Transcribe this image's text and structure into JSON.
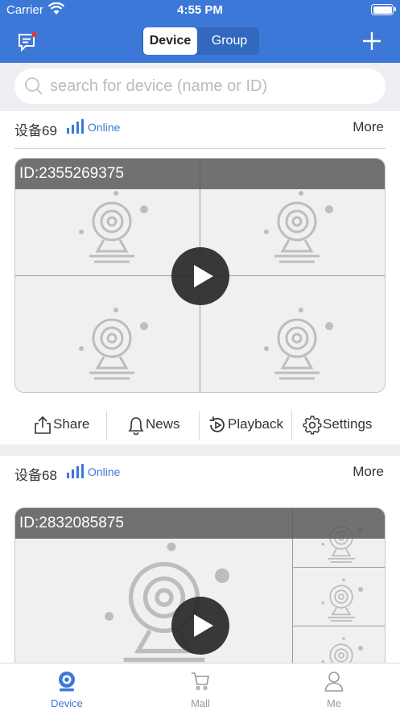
{
  "status_bar": {
    "carrier": "Carrier",
    "time": "4:55 PM"
  },
  "header": {
    "segments": [
      {
        "label": "Device",
        "selected": true
      },
      {
        "label": "Group",
        "selected": false
      }
    ]
  },
  "search": {
    "placeholder": "search for device (name or ID)",
    "value": ""
  },
  "devices": [
    {
      "name": "设备69",
      "status": "Online",
      "more": "More",
      "id_text": "ID:2355269375",
      "layout": "2x2 grid",
      "actions": [
        {
          "label": "Share",
          "icon": "share-icon"
        },
        {
          "label": "News",
          "icon": "bell-icon"
        },
        {
          "label": "Playback",
          "icon": "playback-icon"
        },
        {
          "label": "Settings",
          "icon": "gear-icon"
        }
      ]
    },
    {
      "name": "设备68",
      "status": "Online",
      "more": "More",
      "id_text": "ID:2832085875",
      "layout": "1 large + side thumbnails"
    }
  ],
  "tabs": [
    {
      "label": "Device",
      "icon": "camera-icon",
      "active": true
    },
    {
      "label": "Mall",
      "icon": "cart-icon",
      "active": false
    },
    {
      "label": "Me",
      "icon": "person-icon",
      "active": false
    }
  ],
  "colors": {
    "brand": "#3c78d8",
    "online": "#3c78d8",
    "notification_dot": "#e53935"
  }
}
